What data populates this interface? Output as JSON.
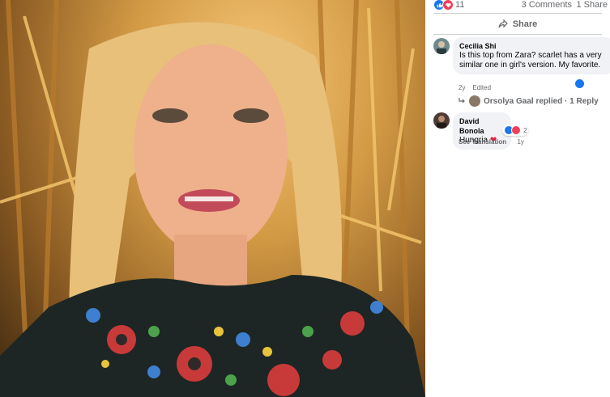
{
  "post_stats": {
    "reaction_count": "11",
    "comments": "3 Comments",
    "shares": "1 Share"
  },
  "share": {
    "label": "Share"
  },
  "comments": [
    {
      "author": "Cecilia Shi",
      "text": "Is this top from Zara? scarlet has a very similar one in girl's version. My favorite.",
      "age": "2y",
      "edited": "Edited",
      "reply_summary": "Orsolya Gaal replied · 1 Reply"
    },
    {
      "author": "David Bonola",
      "text": "Hungria",
      "reaction_count": "2",
      "see_translation": "See Translation",
      "age": "1y"
    }
  ],
  "colors": {
    "like": "#1877f2",
    "love": "#f33e58",
    "bubble": "#f0f2f5",
    "meta": "#65676b"
  }
}
